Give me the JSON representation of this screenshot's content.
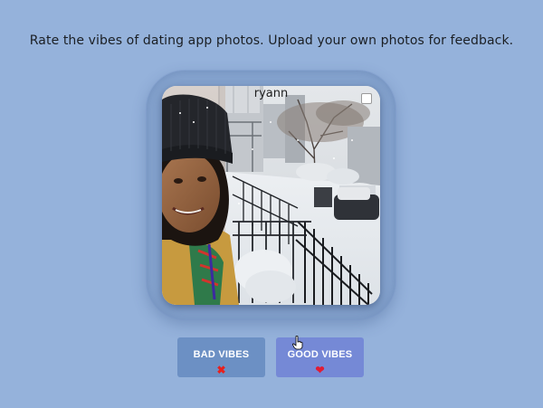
{
  "header": {
    "tagline": "Rate the vibes of dating app photos. Upload your own photos for feedback."
  },
  "photo_card": {
    "name": "ryann"
  },
  "buttons": {
    "bad": {
      "label": "BAD VIBES",
      "icon": "cross-mark-icon",
      "glyph": "✖"
    },
    "good": {
      "label": "GOOD VIBES",
      "icon": "heart-icon",
      "glyph": "❤"
    }
  },
  "colors": {
    "background": "#95b2db",
    "bad_button": "#6c90c4",
    "good_button": "#7589d6",
    "cross": "#e8201d",
    "heart": "#e01c35"
  }
}
